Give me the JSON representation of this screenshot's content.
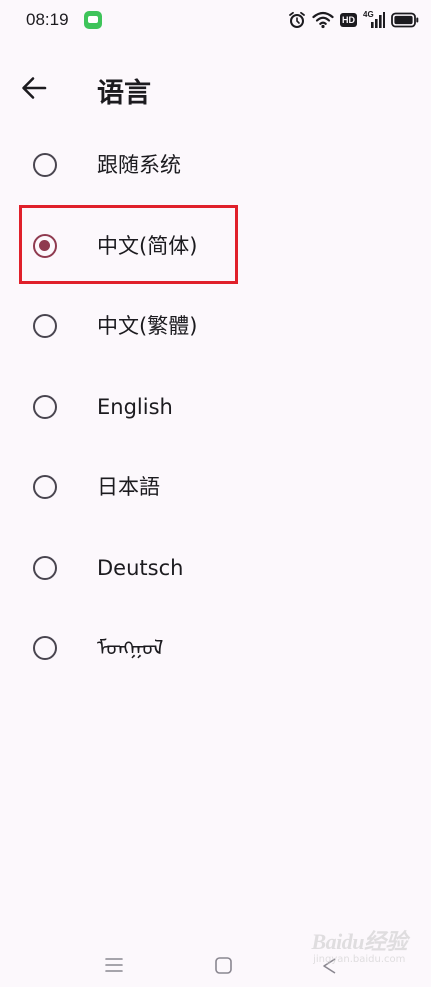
{
  "status_bar": {
    "time": "08:19",
    "network": "4G",
    "hd": "HD"
  },
  "header": {
    "title": "语言"
  },
  "language_options": [
    {
      "label": "跟随系统",
      "selected": false
    },
    {
      "label": "中文(简体)",
      "selected": true
    },
    {
      "label": "中文(繁體)",
      "selected": false
    },
    {
      "label": "English",
      "selected": false
    },
    {
      "label": "日本語",
      "selected": false
    },
    {
      "label": "Deutsch",
      "selected": false
    },
    {
      "label": "ᠮᠣᠩᠭᠣᠯ",
      "selected": false
    }
  ],
  "watermark": {
    "logo": "Baidu经验",
    "url": "jingyan.baidu.com"
  },
  "colors": {
    "background": "#fcf8fc",
    "radio_selected": "#8f3a4f",
    "radio_unselected": "#49454f",
    "highlight_border": "#e0202a",
    "text": "#1c1b1f"
  },
  "icons": {
    "back": "arrow-left-icon",
    "alarm": "alarm-clock-icon",
    "wifi": "wifi-icon",
    "signal": "signal-bars-icon",
    "battery": "battery-icon",
    "message": "message-app-icon",
    "nav_menu": "menu-lines-icon",
    "nav_home": "square-home-icon",
    "nav_back": "triangle-back-icon"
  }
}
